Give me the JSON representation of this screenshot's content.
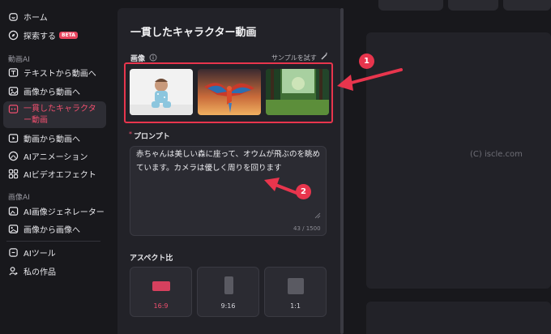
{
  "sidebar": {
    "items_top": [
      {
        "label": "ホーム",
        "icon": "home-icon"
      },
      {
        "label": "探索する",
        "icon": "compass-icon",
        "badge": "BETA"
      }
    ],
    "section_video": "動画AI",
    "items_video": [
      {
        "label": "テキストから動画へ",
        "icon": "text-video-icon"
      },
      {
        "label": "画像から動画へ",
        "icon": "image-video-icon"
      },
      {
        "label": "一貫したキャラクター動画",
        "icon": "character-icon",
        "active": true
      },
      {
        "label": "動画から動画へ",
        "icon": "video-video-icon"
      },
      {
        "label": "AIアニメーション",
        "icon": "ai-animation-icon"
      },
      {
        "label": "AIビデオエフェクト",
        "icon": "effects-icon"
      }
    ],
    "section_image": "画像AI",
    "items_image": [
      {
        "label": "AI画像ジェネレーター",
        "icon": "image-generator-icon"
      },
      {
        "label": "画像から画像へ",
        "icon": "image-image-icon"
      }
    ],
    "items_bottom": [
      {
        "label": "AIツール",
        "icon": "tools-icon"
      },
      {
        "label": "私の作品",
        "icon": "user-icon"
      }
    ]
  },
  "panel": {
    "title": "一貫したキャラクター動画",
    "image_label": "画像",
    "sample_link": "サンプルを試す",
    "prompt_required": "*",
    "prompt_label": "プロンプト",
    "prompt_text": "赤ちゃんは美しい森に座って、オウムが飛ぶのを眺めています。カメラは優しく周りを回ります",
    "prompt_counter": "43 / 1500",
    "aspect_label": "アスペクト比",
    "aspect_options": [
      {
        "label": "16:9",
        "selected": true
      },
      {
        "label": "9:16",
        "selected": false
      },
      {
        "label": "1:1",
        "selected": false
      }
    ]
  },
  "watermark": "(C) iscle.com",
  "annotations": [
    "1",
    "2"
  ],
  "colors": {
    "accent": "#ee4f6e",
    "highlight": "#e8354d",
    "background": "#18181c",
    "panel": "#222228"
  }
}
